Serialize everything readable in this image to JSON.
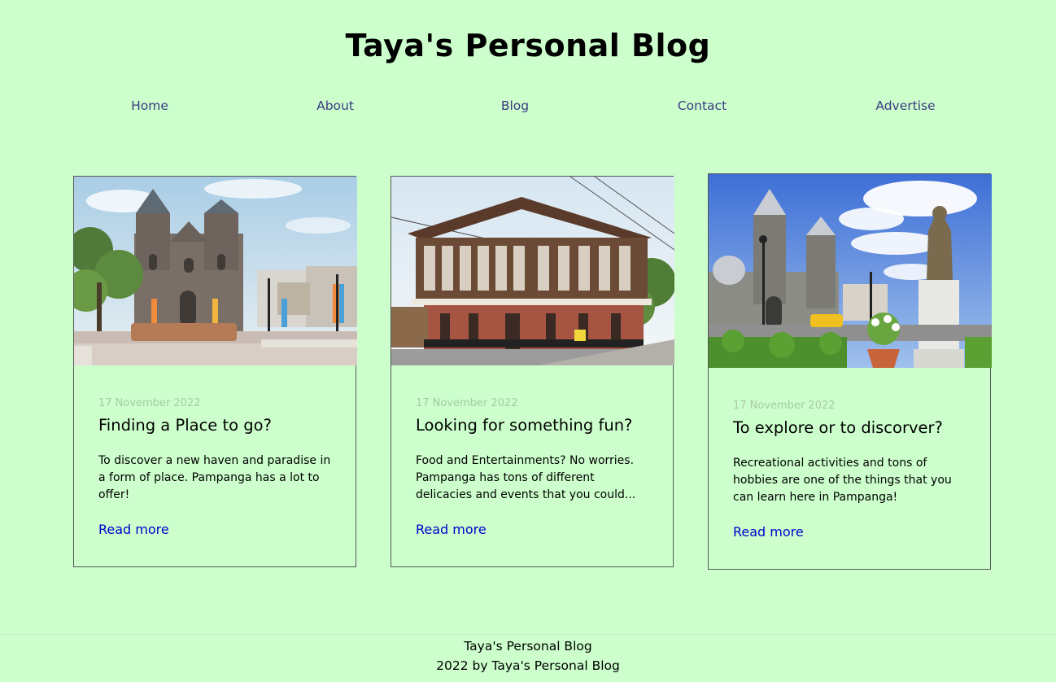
{
  "header": {
    "title": "Taya's Personal Blog"
  },
  "nav": {
    "items": [
      {
        "label": "Home"
      },
      {
        "label": "About"
      },
      {
        "label": "Blog"
      },
      {
        "label": "Contact"
      },
      {
        "label": "Advertise"
      }
    ]
  },
  "posts": [
    {
      "image": "photo-church-plaza-angeles",
      "date": "17 November 2022",
      "title": "Finding a Place to go?",
      "excerpt": "To discover a new haven and paradise in a form of place. Pampanga has a lot to offer!",
      "link_label": "Read more"
    },
    {
      "image": "photo-heritage-house",
      "date": "17 November 2022",
      "title": "Looking for something fun?",
      "excerpt": "Food and Entertainments? No worries. Pampanga has tons of different delicacies and events that you could...",
      "link_label": "Read more"
    },
    {
      "image": "photo-church-statue",
      "date": "17 November 2022",
      "title": "To explore or to discorver?",
      "excerpt": "Recreational activities and tons of hobbies are one of the things that you can learn here in Pampanga!",
      "link_label": "Read more"
    }
  ],
  "footer": {
    "line1": "Taya's Personal Blog",
    "line2": "2022 by Taya's Personal Blog"
  },
  "colors": {
    "background": "#ccffcc",
    "nav_link": "#3b3b80",
    "read_more": "#0000cc",
    "date": "#a8c9a8"
  }
}
